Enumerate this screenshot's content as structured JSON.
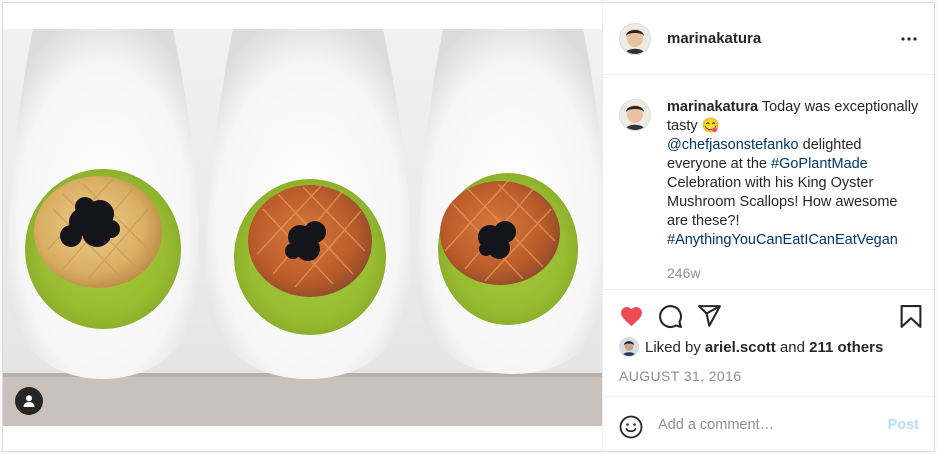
{
  "post": {
    "username": "marinakatura",
    "caption": {
      "username": "marinakatura",
      "text_1": " Today was exceptionally tasty ",
      "emoji": "😋",
      "mention": "@chefjasonstefanko",
      "text_2": " delighted everyone at the ",
      "hashtag_1": "#GoPlantMade",
      "text_3": " Celebration with his King Oyster Mushroom Scallops! How awesome are these?! ",
      "hashtag_2": "#AnythingYouCanEatICanEatVegan"
    },
    "time_ago": "246w",
    "likes": {
      "prefix": "Liked by ",
      "user": "ariel.scott",
      "middle": " and ",
      "others": "211 others"
    },
    "date": "AUGUST 31, 2016",
    "comment": {
      "placeholder": "Add a comment…",
      "post_label": "Post"
    }
  },
  "icons": {
    "like": "heart-filled-icon",
    "comment": "comment-bubble-icon",
    "share": "paper-plane-icon",
    "save": "bookmark-icon",
    "more": "more-dots-icon",
    "emoji": "smiley-icon",
    "tag": "user-tag-icon"
  },
  "colors": {
    "like_red": "#ed4956",
    "link_blue": "#00376b",
    "post_disabled": "#b2dffc",
    "secondary_text": "#8e8e8e",
    "border": "#dbdbdb"
  }
}
